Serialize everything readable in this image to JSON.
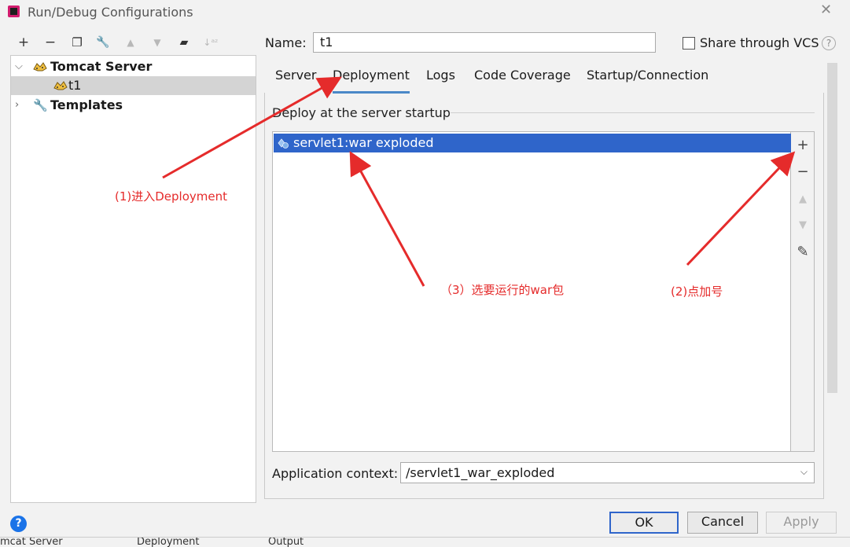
{
  "window": {
    "title": "Run/Debug Configurations",
    "close_icon": "close-icon"
  },
  "toolbar": {
    "icons": [
      "add-icon",
      "remove-icon",
      "copy-icon",
      "wrench-icon",
      "move-up-icon",
      "move-down-icon",
      "folder-add-icon",
      "sort-icon"
    ],
    "glyphs": [
      "+",
      "−",
      "❐",
      "🔧",
      "▲",
      "▼",
      "▰",
      "↓ᵃᶻ"
    ]
  },
  "tree": {
    "group": "Tomcat Server",
    "child": "t1",
    "templates": "Templates"
  },
  "form": {
    "name_label": "Name:",
    "name_value": "t1",
    "share_label": "Share through VCS",
    "help_glyph": "?"
  },
  "tabs": [
    "Server",
    "Deployment",
    "Logs",
    "Code Coverage",
    "Startup/Connection"
  ],
  "active_tab": "Deployment",
  "deployment": {
    "section_title": "Deploy at the server startup",
    "items": [
      "servlet1:war exploded"
    ],
    "side_tools": {
      "add": "+",
      "remove": "−",
      "up": "▲",
      "down": "▼",
      "edit": "✎"
    },
    "app_context_label": "Application context:",
    "app_context_value": "/servlet1_war_exploded"
  },
  "buttons": {
    "ok": "OK",
    "cancel": "Cancel",
    "apply": "Apply",
    "help": "?"
  },
  "background_strip": [
    "mcat Server",
    "Deployment",
    "Output"
  ],
  "annotations": {
    "a1": "(1)进入Deployment",
    "a2": "(2)点加号",
    "a3": "（3）选要运行的war包"
  },
  "colors": {
    "selection": "#2f65ca",
    "tab_underline": "#4a88c7",
    "annotation": "#e52b2b"
  }
}
